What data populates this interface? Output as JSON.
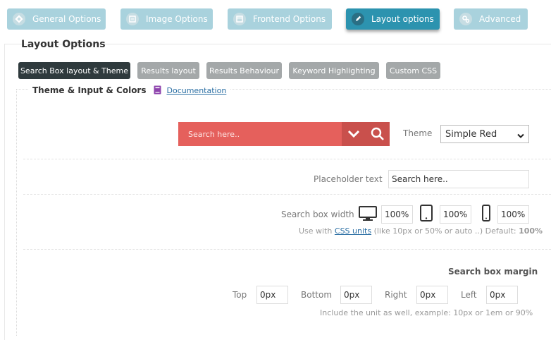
{
  "tabs": [
    {
      "label": "General Options",
      "icon": "gear-icon"
    },
    {
      "label": "Image Options",
      "icon": "image-icon"
    },
    {
      "label": "Frontend Options",
      "icon": "window-icon"
    },
    {
      "label": "Layout options",
      "icon": "pen-icon"
    },
    {
      "label": "Advanced",
      "icon": "gears-icon"
    }
  ],
  "section_title": "Layout Options",
  "subtabs": [
    "Search Box layout & Theme",
    "Results layout",
    "Results Behaviour",
    "Keyword Highlighting",
    "Custom CSS"
  ],
  "fieldset": {
    "legend": "Theme & Input & Colors",
    "doc_link": "Documentation"
  },
  "preview": {
    "placeholder": "Search here..",
    "bar_color": "#e5605c",
    "button_color": "#c9504c"
  },
  "theme": {
    "label": "Theme",
    "selected": "Simple Red"
  },
  "placeholder_text": {
    "label": "Placeholder text",
    "value": "Search here.."
  },
  "width": {
    "label": "Search box width",
    "desktop": "100%",
    "tablet": "100%",
    "phone": "100%",
    "help_prefix": "Use with",
    "help_link": "CSS units",
    "help_suffix": "(like 10px or 50% or auto ..) Default:",
    "help_default": "100%"
  },
  "margin": {
    "title": "Search box margin",
    "top_label": "Top",
    "top_value": "0px",
    "bottom_label": "Bottom",
    "bottom_value": "0px",
    "right_label": "Right",
    "right_value": "0px",
    "left_label": "Left",
    "left_value": "0px",
    "help": "Include the unit as well, example: 10px or 1em or 90%"
  }
}
